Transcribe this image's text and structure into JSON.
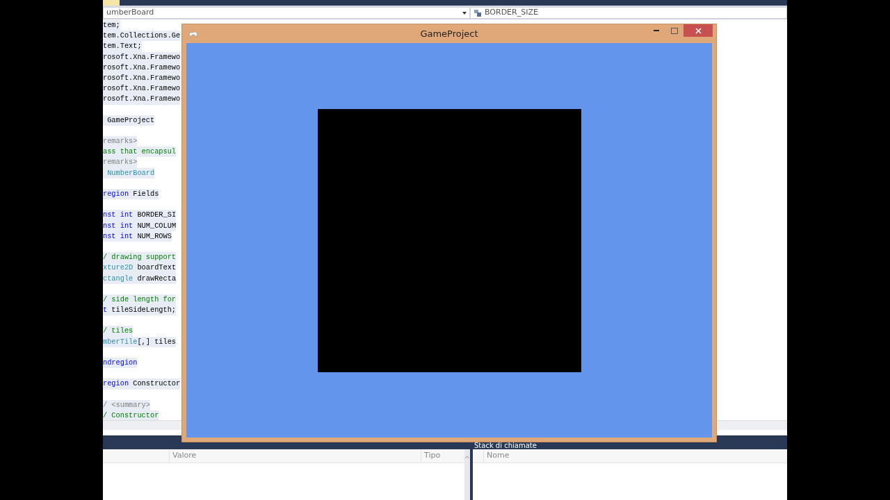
{
  "editor": {
    "type_dropdown": {
      "value": "umberBoard"
    },
    "member_dropdown": {
      "value": "BORDER_SIZE"
    },
    "code_lines": [
      {
        "kind": "code",
        "tokens": [
          {
            "text": "tem;",
            "kind": "plain"
          }
        ]
      },
      {
        "kind": "code",
        "tokens": [
          {
            "text": "tem.Collections.Ge",
            "kind": "plain"
          }
        ]
      },
      {
        "kind": "code",
        "tokens": [
          {
            "text": "tem.Text;",
            "kind": "plain"
          }
        ]
      },
      {
        "kind": "code",
        "tokens": [
          {
            "text": "rosoft.Xna.Framewo",
            "kind": "plain"
          }
        ]
      },
      {
        "kind": "code",
        "tokens": [
          {
            "text": "rosoft.Xna.Framewo",
            "kind": "plain"
          }
        ]
      },
      {
        "kind": "code",
        "tokens": [
          {
            "text": "rosoft.Xna.Framewo",
            "kind": "plain"
          }
        ]
      },
      {
        "kind": "code",
        "tokens": [
          {
            "text": "rosoft.Xna.Framewo",
            "kind": "plain"
          }
        ]
      },
      {
        "kind": "code",
        "tokens": [
          {
            "text": "rosoft.Xna.Framewo",
            "kind": "plain"
          }
        ]
      },
      {
        "kind": "blank"
      },
      {
        "kind": "code",
        "tokens": [
          {
            "text": " GameProject",
            "kind": "plain"
          }
        ]
      },
      {
        "kind": "blank"
      },
      {
        "kind": "code",
        "tokens": [
          {
            "text": "remarks>",
            "kind": "doc"
          }
        ]
      },
      {
        "kind": "code",
        "tokens": [
          {
            "text": "ass that encapsul",
            "kind": "comment"
          }
        ]
      },
      {
        "kind": "code",
        "tokens": [
          {
            "text": "remarks>",
            "kind": "doc"
          }
        ]
      },
      {
        "kind": "code",
        "tokens": [
          {
            "text": " NumberBoard",
            "kind": "type"
          }
        ]
      },
      {
        "kind": "blank"
      },
      {
        "kind": "code",
        "tokens": [
          {
            "text": "region",
            "kind": "keyword"
          },
          {
            "text": " Fields",
            "kind": "plain"
          }
        ]
      },
      {
        "kind": "blank"
      },
      {
        "kind": "code",
        "tokens": [
          {
            "text": "nst int",
            "kind": "keyword"
          },
          {
            "text": " BORDER_SI",
            "kind": "plain"
          }
        ]
      },
      {
        "kind": "code",
        "tokens": [
          {
            "text": "nst int",
            "kind": "keyword"
          },
          {
            "text": " NUM_COLUM",
            "kind": "plain"
          }
        ]
      },
      {
        "kind": "code",
        "tokens": [
          {
            "text": "nst int",
            "kind": "keyword"
          },
          {
            "text": " NUM_ROWS",
            "kind": "plain"
          }
        ]
      },
      {
        "kind": "blank"
      },
      {
        "kind": "code",
        "tokens": [
          {
            "text": "/ drawing support",
            "kind": "comment"
          }
        ]
      },
      {
        "kind": "code",
        "tokens": [
          {
            "text": "xture2D",
            "kind": "type"
          },
          {
            "text": " boardText",
            "kind": "plain"
          }
        ]
      },
      {
        "kind": "code",
        "tokens": [
          {
            "text": "ctangle",
            "kind": "type"
          },
          {
            "text": " drawRecta",
            "kind": "plain"
          }
        ]
      },
      {
        "kind": "blank"
      },
      {
        "kind": "code",
        "tokens": [
          {
            "text": "/ side length for",
            "kind": "comment"
          }
        ]
      },
      {
        "kind": "code",
        "tokens": [
          {
            "text": "t",
            "kind": "keyword"
          },
          {
            "text": " tileSideLength;",
            "kind": "plain"
          }
        ]
      },
      {
        "kind": "blank"
      },
      {
        "kind": "code",
        "tokens": [
          {
            "text": "/ tiles",
            "kind": "comment"
          }
        ]
      },
      {
        "kind": "code",
        "tokens": [
          {
            "text": "mberTile",
            "kind": "type"
          },
          {
            "text": "[,] tiles",
            "kind": "plain"
          }
        ]
      },
      {
        "kind": "blank"
      },
      {
        "kind": "code",
        "tokens": [
          {
            "text": "ndregion",
            "kind": "keyword"
          }
        ]
      },
      {
        "kind": "blank"
      },
      {
        "kind": "code",
        "tokens": [
          {
            "text": "region",
            "kind": "keyword"
          },
          {
            "text": " Constructor",
            "kind": "plain"
          }
        ]
      },
      {
        "kind": "blank"
      },
      {
        "kind": "code",
        "tokens": [
          {
            "text": "/ <summary>",
            "kind": "doc"
          }
        ]
      },
      {
        "kind": "code",
        "tokens": [
          {
            "text": "/ Constructor",
            "kind": "comment"
          }
        ]
      }
    ]
  },
  "game_window": {
    "title": "GameProject"
  },
  "locals_panel": {
    "columns": [
      "Valore",
      "Tipo"
    ]
  },
  "call_stack_panel": {
    "title": "Stack di chiamate",
    "columns": [
      "Nome"
    ]
  }
}
